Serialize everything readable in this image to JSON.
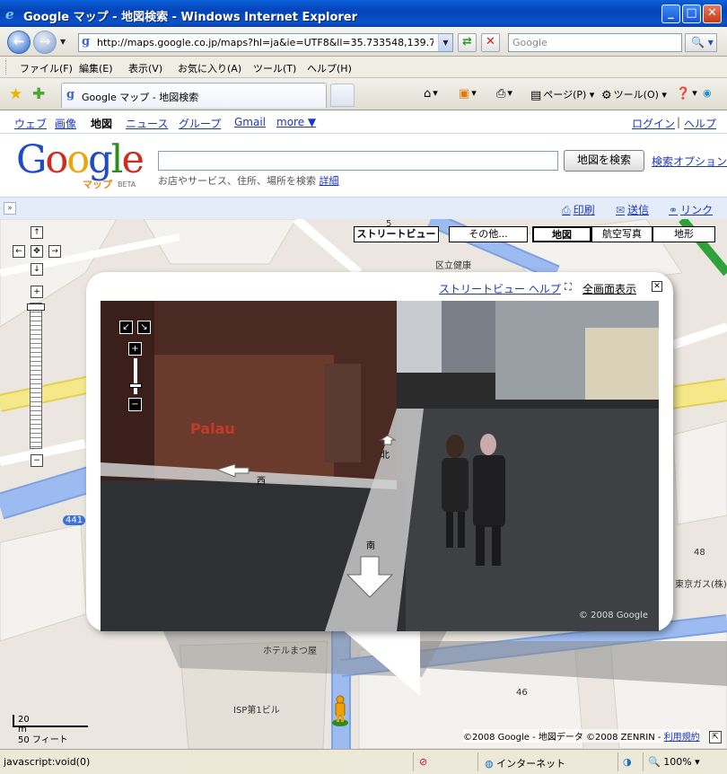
{
  "window": {
    "title": "Google マップ - 地図検索 - Windows Internet Explorer",
    "minimize": "_",
    "maximize": "□",
    "close": "✕"
  },
  "address_bar": {
    "url": "http://maps.google.co.jp/maps?hl=ja&ie=UTF8&ll=35.733548,139.714876&spn",
    "search_placeholder": "Google"
  },
  "menu": [
    "ファイル(F)",
    "編集(E)",
    "表示(V)",
    "お気に入り(A)",
    "ツール(T)",
    "ヘルプ(H)"
  ],
  "tab": {
    "label": "Google マップ - 地図検索"
  },
  "command_bar": {
    "page": "ページ(P)",
    "tools": "ツール(O)"
  },
  "google_nav": {
    "items": [
      "ウェブ",
      "画像",
      "地図",
      "ニュース",
      "グループ",
      "Gmail",
      "more ▼"
    ],
    "selected": "地図",
    "login": "ログイン",
    "help": "ヘルプ"
  },
  "google_header": {
    "logo_sub": "マップ",
    "logo_beta": "BETA",
    "search_button": "地図を検索",
    "search_options": "検索オプション",
    "hint": "お店やサービス、住所、場所を検索",
    "hint_link": "詳細"
  },
  "actions": {
    "print": "印刷",
    "send": "送信",
    "link": "リンク"
  },
  "map": {
    "types": [
      "ストリートビュー",
      "その他...",
      "地図",
      "航空写真",
      "地形"
    ],
    "selected_type": "地図",
    "scale": {
      "meters": "20 m",
      "feet": "50 フィート"
    },
    "copyright": "©2008 Google - 地図データ ©2008 ZENRIN -",
    "terms": "利用規約",
    "labels": {
      "route": "441",
      "hotel": "ホテルまつ屋",
      "isp": "ISP第1ビル",
      "tokyo_gas": "東京ガス(株)",
      "num_48": "48",
      "num_46": "46",
      "num_5": "5",
      "ward": "区立健康"
    }
  },
  "street_view": {
    "help": "ストリートビュー ヘルプ",
    "fullscreen": "全画面表示",
    "close": "✕",
    "directions": {
      "west": "西",
      "north": "北",
      "south": "南"
    },
    "copyright": "© 2008 Google",
    "sign": "Palau"
  },
  "status_bar": {
    "text": "javascript:void(0)",
    "zone": "インターネット",
    "zoom": "100%"
  },
  "colors": {
    "title_bar": "#0a52c9",
    "link": "#1e35c0",
    "map_bg": "#ebe7e0",
    "road_blue": "#9cbbf0",
    "road_yellow": "#f5e88a"
  }
}
